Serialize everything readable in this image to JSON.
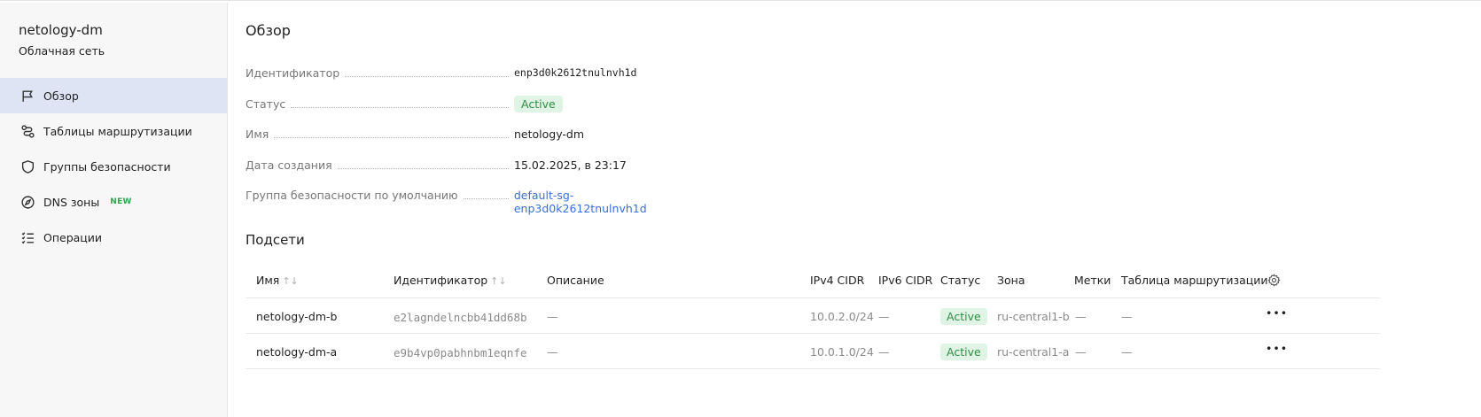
{
  "sidebar": {
    "title": "netology-dm",
    "subtitle": "Облачная сеть",
    "items": [
      {
        "label": "Обзор",
        "icon": "flag-icon",
        "active": true
      },
      {
        "label": "Таблицы маршрутизации",
        "icon": "route-icon"
      },
      {
        "label": "Группы безопасности",
        "icon": "shield-icon"
      },
      {
        "label": "DNS зоны",
        "icon": "compass-icon",
        "badge": "NEW"
      },
      {
        "label": "Операции",
        "icon": "list-icon"
      }
    ]
  },
  "overview": {
    "title": "Обзор",
    "props": [
      {
        "key": "Идентификатор",
        "value": "enp3d0k2612tnulnvh1d"
      },
      {
        "key": "Статус",
        "value": "Active"
      },
      {
        "key": "Имя",
        "value": "netology-dm"
      },
      {
        "key": "Дата создания",
        "value": "15.02.2025, в 23:17"
      },
      {
        "key": "Группа безопасности по умолчанию",
        "value": "default-sg-enp3d0k2612tnulnvh1d"
      }
    ]
  },
  "subnets": {
    "title": "Подсети",
    "columns": [
      "Имя",
      "Идентификатор",
      "Описание",
      "IPv4 CIDR",
      "IPv6 CIDR",
      "Статус",
      "Зона",
      "Метки",
      "Таблица маршрутизации"
    ],
    "sort_glyph": "↑↓",
    "menu_glyph": "•••",
    "rows": [
      {
        "name": "netology-dm-b",
        "id": "e2lagndelncbb41dd68b",
        "description": "—",
        "ipv4": "10.0.2.0/24",
        "ipv6": "—",
        "status": "Active",
        "zone": "ru-central1-b",
        "labels": "—",
        "route_table": "—"
      },
      {
        "name": "netology-dm-a",
        "id": "e9b4vp0pabhnbm1eqnfe",
        "description": "—",
        "ipv4": "10.0.1.0/24",
        "ipv6": "—",
        "status": "Active",
        "zone": "ru-central1-a",
        "labels": "—",
        "route_table": "—"
      }
    ]
  },
  "colors": {
    "accent": "#3a6fd8",
    "active_nav_bg": "#dfe4f5",
    "status_bg": "#e0f4e5",
    "status_text": "#2c8d44",
    "new_badge": "#2fa84f"
  }
}
